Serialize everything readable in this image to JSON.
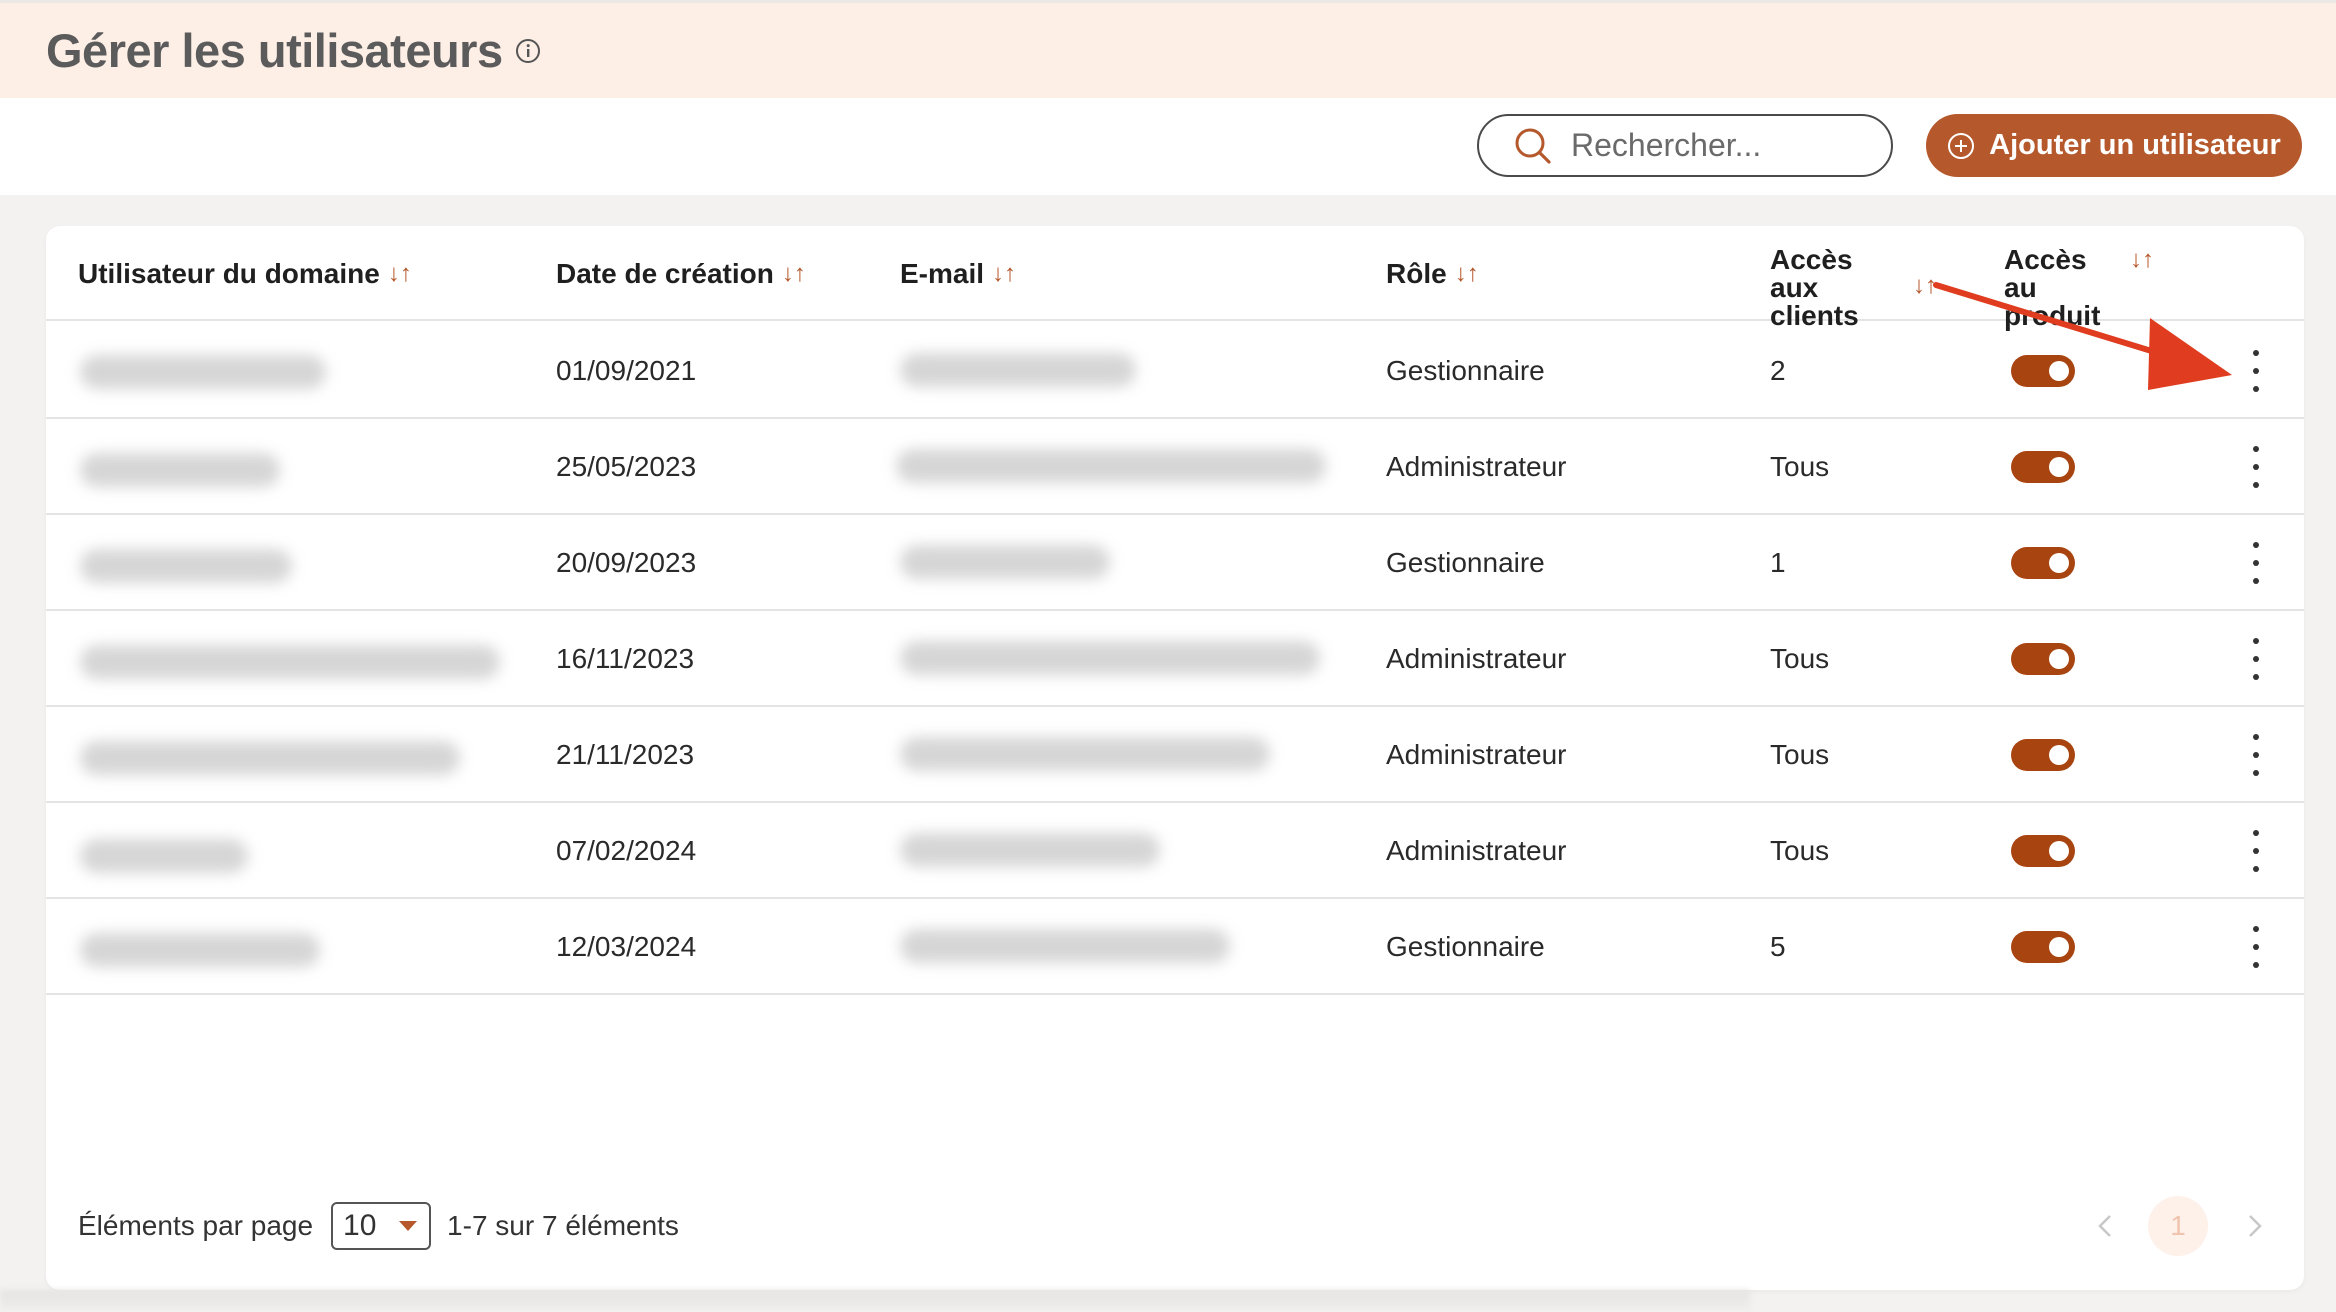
{
  "header": {
    "title": "Gérer les utilisateurs"
  },
  "toolbar": {
    "search_placeholder": "Rechercher...",
    "add_label": "Ajouter un utilisateur"
  },
  "table": {
    "columns": [
      {
        "label": "Utilisateur du domaine"
      },
      {
        "label": "Date de création"
      },
      {
        "label": "E-mail"
      },
      {
        "label": "Rôle"
      },
      {
        "label": "Accès aux clients"
      },
      {
        "label": "Accès au produit"
      }
    ],
    "sort_symbol": "↓↑",
    "rows": [
      {
        "date": "01/09/2021",
        "role": "Gestionnaire",
        "access": "2",
        "product_access": true
      },
      {
        "date": "25/05/2023",
        "role": "Administrateur",
        "access": "Tous",
        "product_access": true
      },
      {
        "date": "20/09/2023",
        "role": "Gestionnaire",
        "access": "1",
        "product_access": true
      },
      {
        "date": "16/11/2023",
        "role": "Administrateur",
        "access": "Tous",
        "product_access": true
      },
      {
        "date": "21/11/2023",
        "role": "Administrateur",
        "access": "Tous",
        "product_access": true
      },
      {
        "date": "07/02/2024",
        "role": "Administrateur",
        "access": "Tous",
        "product_access": true
      },
      {
        "date": "12/03/2024",
        "role": "Gestionnaire",
        "access": "5",
        "product_access": true
      }
    ]
  },
  "footer": {
    "per_page_label": "Éléments par page",
    "per_page_value": "10",
    "range_text": "1-7 sur 7 éléments",
    "current_page": "1"
  },
  "colors": {
    "accent": "#b5592d",
    "toggle_on": "#a84410",
    "header_bg": "#fdeee6",
    "annotation_arrow": "#e03c1f"
  }
}
